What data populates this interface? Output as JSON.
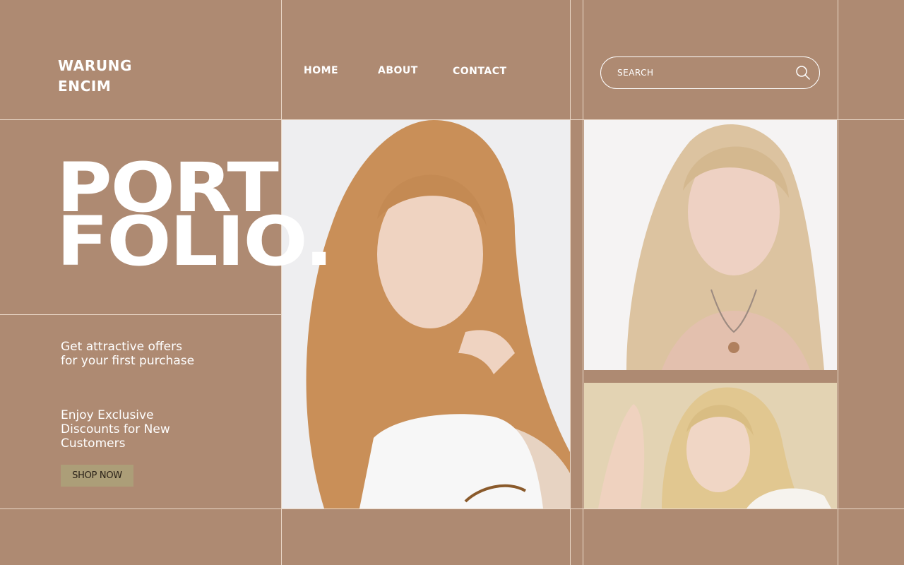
{
  "brand": {
    "line1": "WARUNG",
    "line2": "ENCIM"
  },
  "nav": {
    "home": "HOME",
    "about": "ABOUT",
    "contact": "CONTACT"
  },
  "search": {
    "placeholder": "SEARCH",
    "icon": "search-icon"
  },
  "hero": {
    "line1": "PORT",
    "line2": "FOLIO."
  },
  "offers": {
    "offer1": "Get attractive offers for your first purchase",
    "offer2": "Enjoy Exclusive Discounts for New Customers"
  },
  "cta": {
    "shop_now": "SHOP NOW"
  },
  "colors": {
    "background": "#ae8a72",
    "line": "#ead8c8",
    "button": "#ac9e78",
    "text": "#ffffff"
  }
}
